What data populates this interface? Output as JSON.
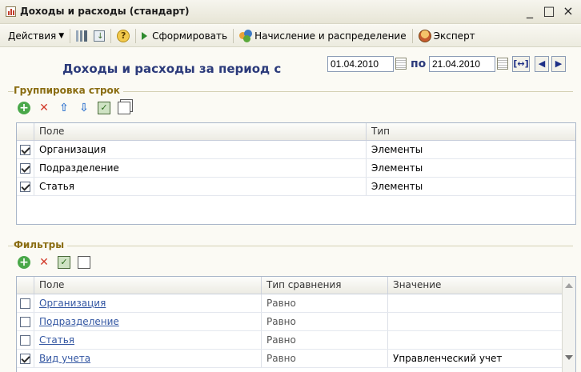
{
  "window": {
    "title": "Доходы и расходы (стандарт)",
    "controls": [
      "_",
      "□",
      "×"
    ]
  },
  "toolbar": {
    "actions_label": "Действия",
    "generate_label": "Сформировать",
    "accrual_label": "Начисление и распределение",
    "expert_label": "Эксперт"
  },
  "header": {
    "period_title": "Доходы и расходы  за период с",
    "date_from": "01.04.2010",
    "date_to_label": "по",
    "date_to": "21.04.2010"
  },
  "grouping": {
    "section_label": "Группировка строк",
    "columns": [
      "Поле",
      "Тип"
    ],
    "rows": [
      {
        "field": "Организация",
        "type": "Элементы",
        "checked": true
      },
      {
        "field": "Подразделение",
        "type": "Элементы",
        "checked": true
      },
      {
        "field": "Статья",
        "type": "Элементы",
        "checked": true
      }
    ]
  },
  "filters": {
    "section_label": "Фильтры",
    "columns": [
      "Поле",
      "Тип сравнения",
      "Значение"
    ],
    "rows": [
      {
        "field": "Организация",
        "comparison": "Равно",
        "value": "",
        "checked": false
      },
      {
        "field": "Подразделение",
        "comparison": "Равно",
        "value": "",
        "checked": false
      },
      {
        "field": "Статья",
        "comparison": "Равно",
        "value": "",
        "checked": false
      },
      {
        "field": "Вид учета",
        "comparison": "Равно",
        "value": "Управленческий учет",
        "checked": true
      }
    ]
  },
  "colors": {
    "section": "#8a6d12",
    "title": "#2b3a7a",
    "link": "#3457a3"
  }
}
